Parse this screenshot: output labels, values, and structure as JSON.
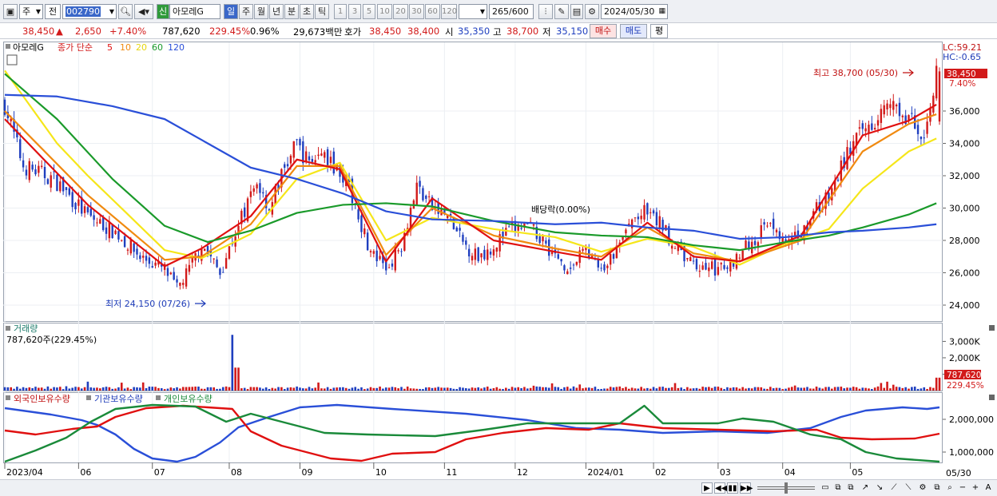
{
  "toolbar": {
    "period_label": "주",
    "prev_label": "전",
    "code_value": "002790",
    "name_badge": "신",
    "stock_name": "아모레G",
    "period_tabs": [
      "일",
      "주",
      "월",
      "년",
      "분",
      "초",
      "틱"
    ],
    "active_tab": "일",
    "num_buttons": [
      "1",
      "3",
      "5",
      "10",
      "20",
      "30",
      "60",
      "120"
    ],
    "count_value": "265",
    "count_total": "/600",
    "date_value": "2024/05/30"
  },
  "quote": {
    "price": "38,450",
    "change": "2,650",
    "change_pct": "+7.40%",
    "volume": "787,620",
    "volume_ratio": "229.45%",
    "turnover": "0.96%",
    "amount": "29,673백만",
    "ask_label": "호가",
    "ask_value": "38,450",
    "bid_value": "38,400",
    "open_label": "시",
    "open_value": "35,350",
    "high_label": "고",
    "high_value": "38,700",
    "low_label": "저",
    "low_value": "35,150",
    "buy_label": "매수",
    "sell_label": "매도",
    "eval_label": "평"
  },
  "chart": {
    "legend_name": "아모레G",
    "legend_text": "종가 단순",
    "ma_periods": [
      "5",
      "10",
      "20",
      "60",
      "120"
    ],
    "lc_label": "LC:59.21",
    "hc_label": "HC:-0.65",
    "price_badge": "38,450",
    "pct_badge": "7.40%",
    "high_annot": "최고 38,700 (05/30)",
    "low_annot": "최저 24,150 (07/26)",
    "dividend_annot": "배당락(0.00%)",
    "volume_title": "거래량",
    "volume_info": "787,620주(229.45%)",
    "volume_badge": "787,620",
    "volume_pct_badge": "229.45%",
    "holding_legend": [
      "외국인보유수량",
      "기관보유수량",
      "개인보유수량"
    ],
    "date_labels": [
      "2023/04",
      "06",
      "07",
      "08",
      "09",
      "10",
      "11",
      "12",
      "2024/01",
      "02",
      "03",
      "04",
      "05"
    ],
    "last_date": "05/30"
  },
  "colors": {
    "up": "#d21a1a",
    "down": "#1f3fbf",
    "ma5": "#e01010",
    "ma10": "#f08a10",
    "ma20": "#f5e61a",
    "ma60": "#1a9a2a",
    "ma120": "#2a4fd8"
  },
  "chart_data": {
    "type": "line",
    "title": "아모레G",
    "price_axis": {
      "ticks": [
        24000,
        26000,
        28000,
        30000,
        32000,
        34000,
        36000
      ],
      "ylim": [
        23000,
        39500
      ]
    },
    "volume_axis": {
      "ticks": [
        "1,000K",
        "2,000K",
        "3,000K"
      ],
      "ylim": [
        0,
        3800000
      ]
    },
    "holding_axis": {
      "ticks": [
        "1,000,000",
        "2,000,000"
      ]
    },
    "x": [
      "2023/04",
      "06",
      "07",
      "08",
      "09",
      "10",
      "11",
      "12",
      "2024/01",
      "02",
      "03",
      "04",
      "05",
      "05/30"
    ],
    "x_index": [
      0,
      24,
      48,
      73,
      96,
      120,
      143,
      166,
      189,
      211,
      232,
      253,
      275,
      304
    ],
    "series": [
      {
        "name": "종가",
        "x_index": [
          0,
          6,
          16,
          27,
          36,
          44,
          52,
          56,
          60,
          64,
          70,
          74,
          78,
          82,
          86,
          90,
          95,
          98,
          103,
          109,
          114,
          119,
          124,
          129,
          134,
          139,
          144,
          149,
          154,
          159,
          164,
          169,
          174,
          179,
          184,
          189,
          194,
          199,
          204,
          208,
          214,
          219,
          224,
          229,
          234,
          239,
          244,
          249,
          254,
          259,
          264,
          268,
          274,
          279,
          284,
          289,
          294,
          299,
          303
        ],
        "values": [
          36400,
          32600,
          31800,
          29500,
          28500,
          27000,
          26200,
          25000,
          26200,
          27800,
          26000,
          28000,
          29800,
          31600,
          30000,
          32000,
          34000,
          33000,
          33200,
          32400,
          30200,
          27200,
          26200,
          27800,
          31400,
          30000,
          29500,
          27800,
          27000,
          27700,
          28600,
          28900,
          28300,
          27000,
          26200,
          27600,
          25900,
          27400,
          29200,
          29700,
          28900,
          27300,
          26400,
          26400,
          26100,
          27300,
          28000,
          29400,
          27600,
          28400,
          30000,
          30600,
          33400,
          34700,
          35800,
          36100,
          35600,
          34200,
          38450
        ]
      },
      {
        "name": "5",
        "x_index": [
          0,
          27,
          52,
          64,
          80,
          95,
          109,
          124,
          139,
          159,
          179,
          194,
          209,
          224,
          239,
          259,
          279,
          294,
          303
        ],
        "values": [
          35500,
          30200,
          26400,
          27500,
          29500,
          33000,
          32400,
          26700,
          30600,
          28000,
          27300,
          26800,
          29100,
          27000,
          26700,
          28300,
          34500,
          35400,
          36400
        ]
      },
      {
        "name": "10",
        "x_index": [
          0,
          27,
          52,
          64,
          80,
          95,
          109,
          124,
          139,
          159,
          179,
          194,
          209,
          224,
          239,
          259,
          279,
          294,
          303
        ],
        "values": [
          36000,
          30800,
          26800,
          27000,
          29000,
          32600,
          32600,
          27100,
          30000,
          28300,
          27500,
          27000,
          28800,
          27200,
          26700,
          28000,
          33500,
          35200,
          35800
        ]
      },
      {
        "name": "20",
        "x_index": [
          0,
          17,
          27,
          39,
          52,
          64,
          80,
          95,
          109,
          124,
          139,
          159,
          179,
          194,
          209,
          224,
          239,
          254,
          268,
          279,
          294,
          303
        ],
        "values": [
          38500,
          34000,
          32000,
          29800,
          27400,
          26900,
          28400,
          31800,
          32800,
          28000,
          29400,
          28700,
          28200,
          27300,
          28100,
          27600,
          26500,
          27800,
          28700,
          31200,
          33500,
          34300
        ]
      },
      {
        "name": "60",
        "x_index": [
          0,
          17,
          35,
          52,
          66,
          80,
          95,
          110,
          124,
          139,
          159,
          179,
          194,
          209,
          224,
          239,
          254,
          268,
          279,
          294,
          303
        ],
        "values": [
          38300,
          35500,
          31800,
          28900,
          27900,
          28600,
          29700,
          30200,
          30300,
          30100,
          29200,
          28500,
          28300,
          28200,
          27700,
          27400,
          27900,
          28300,
          28800,
          29600,
          30300
        ]
      },
      {
        "name": "120",
        "x_index": [
          0,
          17,
          35,
          52,
          66,
          80,
          95,
          110,
          124,
          139,
          159,
          179,
          194,
          209,
          224,
          239,
          254,
          268,
          279,
          294,
          303
        ],
        "values": [
          37000,
          36900,
          36300,
          35500,
          34000,
          32500,
          31800,
          30900,
          29800,
          29300,
          29200,
          29000,
          29100,
          28800,
          28600,
          28100,
          28200,
          28500,
          28600,
          28800,
          29000
        ]
      }
    ]
  }
}
